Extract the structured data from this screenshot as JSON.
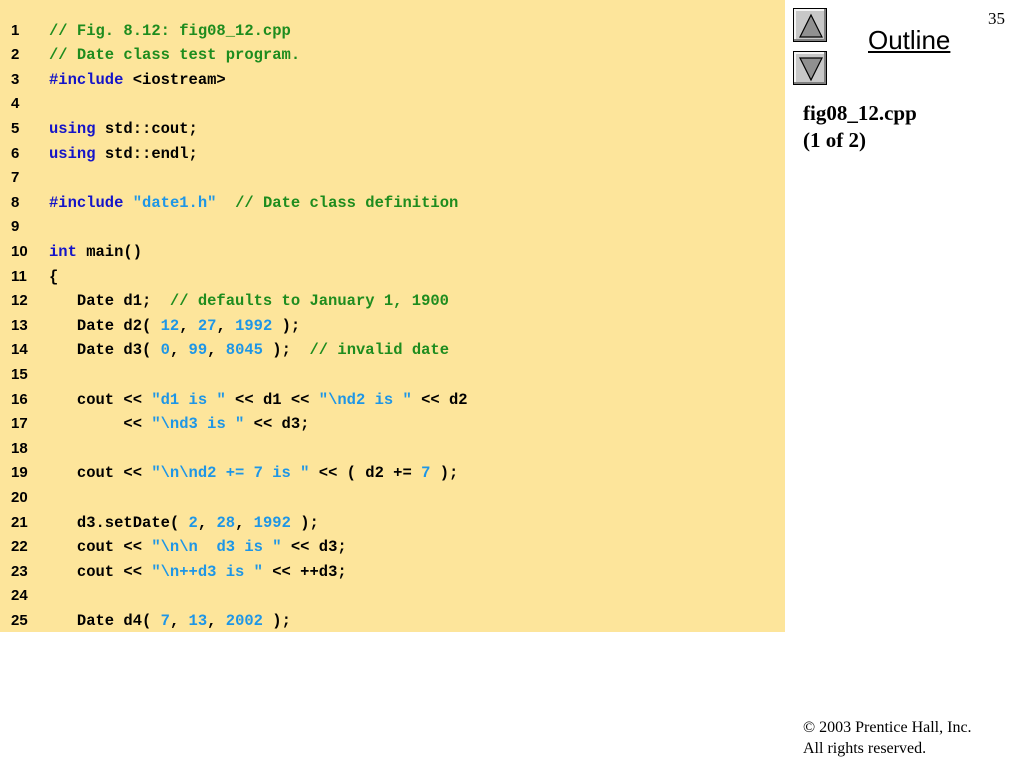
{
  "slide": {
    "number": "35"
  },
  "navigation": {
    "outline_label": "Outline",
    "up_icon": "triangle-up-icon",
    "down_icon": "triangle-down-icon"
  },
  "file": {
    "name": "fig08_12.cpp",
    "part": "(1 of 2)"
  },
  "footer": {
    "copyright": "© 2003 Prentice Hall, Inc.",
    "rights": "All rights reserved."
  },
  "colors": {
    "panel_background": "#fde59b",
    "comment": "#1e8c1e",
    "keyword": "#1414c8",
    "literal": "#1e96e6"
  },
  "code_lines": [
    {
      "num": "1",
      "tokens": [
        {
          "t": "// Fig. 8.12: fig08_12.cpp",
          "c": "comment"
        }
      ]
    },
    {
      "num": "2",
      "tokens": [
        {
          "t": "// Date class test program.",
          "c": "comment"
        }
      ]
    },
    {
      "num": "3",
      "tokens": [
        {
          "t": "#include",
          "c": "keyword"
        },
        {
          "t": " <iostream>",
          "c": "plain"
        }
      ]
    },
    {
      "num": "4",
      "tokens": []
    },
    {
      "num": "5",
      "tokens": [
        {
          "t": "using",
          "c": "keyword"
        },
        {
          "t": " std::cout;",
          "c": "plain"
        }
      ]
    },
    {
      "num": "6",
      "tokens": [
        {
          "t": "using",
          "c": "keyword"
        },
        {
          "t": " std::endl;",
          "c": "plain"
        }
      ]
    },
    {
      "num": "7",
      "tokens": []
    },
    {
      "num": "8",
      "tokens": [
        {
          "t": "#include",
          "c": "keyword"
        },
        {
          "t": " ",
          "c": "plain"
        },
        {
          "t": "\"date1.h\"",
          "c": "string"
        },
        {
          "t": "  ",
          "c": "plain"
        },
        {
          "t": "// Date class definition",
          "c": "comment"
        }
      ]
    },
    {
      "num": "9",
      "tokens": []
    },
    {
      "num": "10",
      "tokens": [
        {
          "t": "int",
          "c": "keyword"
        },
        {
          "t": " main()",
          "c": "plain"
        }
      ]
    },
    {
      "num": "11",
      "tokens": [
        {
          "t": "{",
          "c": "plain"
        }
      ]
    },
    {
      "num": "12",
      "tokens": [
        {
          "t": "   Date d1;  ",
          "c": "plain"
        },
        {
          "t": "// defaults to January 1, 1900",
          "c": "comment"
        }
      ]
    },
    {
      "num": "13",
      "tokens": [
        {
          "t": "   Date d2( ",
          "c": "plain"
        },
        {
          "t": "12",
          "c": "number"
        },
        {
          "t": ", ",
          "c": "plain"
        },
        {
          "t": "27",
          "c": "number"
        },
        {
          "t": ", ",
          "c": "plain"
        },
        {
          "t": "1992",
          "c": "number"
        },
        {
          "t": " );",
          "c": "plain"
        }
      ]
    },
    {
      "num": "14",
      "tokens": [
        {
          "t": "   Date d3( ",
          "c": "plain"
        },
        {
          "t": "0",
          "c": "number"
        },
        {
          "t": ", ",
          "c": "plain"
        },
        {
          "t": "99",
          "c": "number"
        },
        {
          "t": ", ",
          "c": "plain"
        },
        {
          "t": "8045",
          "c": "number"
        },
        {
          "t": " );  ",
          "c": "plain"
        },
        {
          "t": "// invalid date",
          "c": "comment"
        }
      ]
    },
    {
      "num": "15",
      "tokens": []
    },
    {
      "num": "16",
      "tokens": [
        {
          "t": "   cout << ",
          "c": "plain"
        },
        {
          "t": "\"d1 is \"",
          "c": "string"
        },
        {
          "t": " << d1 << ",
          "c": "plain"
        },
        {
          "t": "\"\\nd2 is \"",
          "c": "string"
        },
        {
          "t": " << d2",
          "c": "plain"
        }
      ]
    },
    {
      "num": "17",
      "tokens": [
        {
          "t": "        << ",
          "c": "plain"
        },
        {
          "t": "\"\\nd3 is \"",
          "c": "string"
        },
        {
          "t": " << d3;",
          "c": "plain"
        }
      ]
    },
    {
      "num": "18",
      "tokens": []
    },
    {
      "num": "19",
      "tokens": [
        {
          "t": "   cout << ",
          "c": "plain"
        },
        {
          "t": "\"\\n\\nd2 += 7 is \"",
          "c": "string"
        },
        {
          "t": " << ( d2 += ",
          "c": "plain"
        },
        {
          "t": "7",
          "c": "number"
        },
        {
          "t": " );",
          "c": "plain"
        }
      ]
    },
    {
      "num": "20",
      "tokens": []
    },
    {
      "num": "21",
      "tokens": [
        {
          "t": "   d3.setDate( ",
          "c": "plain"
        },
        {
          "t": "2",
          "c": "number"
        },
        {
          "t": ", ",
          "c": "plain"
        },
        {
          "t": "28",
          "c": "number"
        },
        {
          "t": ", ",
          "c": "plain"
        },
        {
          "t": "1992",
          "c": "number"
        },
        {
          "t": " );",
          "c": "plain"
        }
      ]
    },
    {
      "num": "22",
      "tokens": [
        {
          "t": "   cout << ",
          "c": "plain"
        },
        {
          "t": "\"\\n\\n  d3 is \"",
          "c": "string"
        },
        {
          "t": " << d3;",
          "c": "plain"
        }
      ]
    },
    {
      "num": "23",
      "tokens": [
        {
          "t": "   cout << ",
          "c": "plain"
        },
        {
          "t": "\"\\n++d3 is \"",
          "c": "string"
        },
        {
          "t": " << ++d3;",
          "c": "plain"
        }
      ]
    },
    {
      "num": "24",
      "tokens": []
    },
    {
      "num": "25",
      "tokens": [
        {
          "t": "   Date d4( ",
          "c": "plain"
        },
        {
          "t": "7",
          "c": "number"
        },
        {
          "t": ", ",
          "c": "plain"
        },
        {
          "t": "13",
          "c": "number"
        },
        {
          "t": ", ",
          "c": "plain"
        },
        {
          "t": "2002",
          "c": "number"
        },
        {
          "t": " );",
          "c": "plain"
        }
      ]
    }
  ]
}
